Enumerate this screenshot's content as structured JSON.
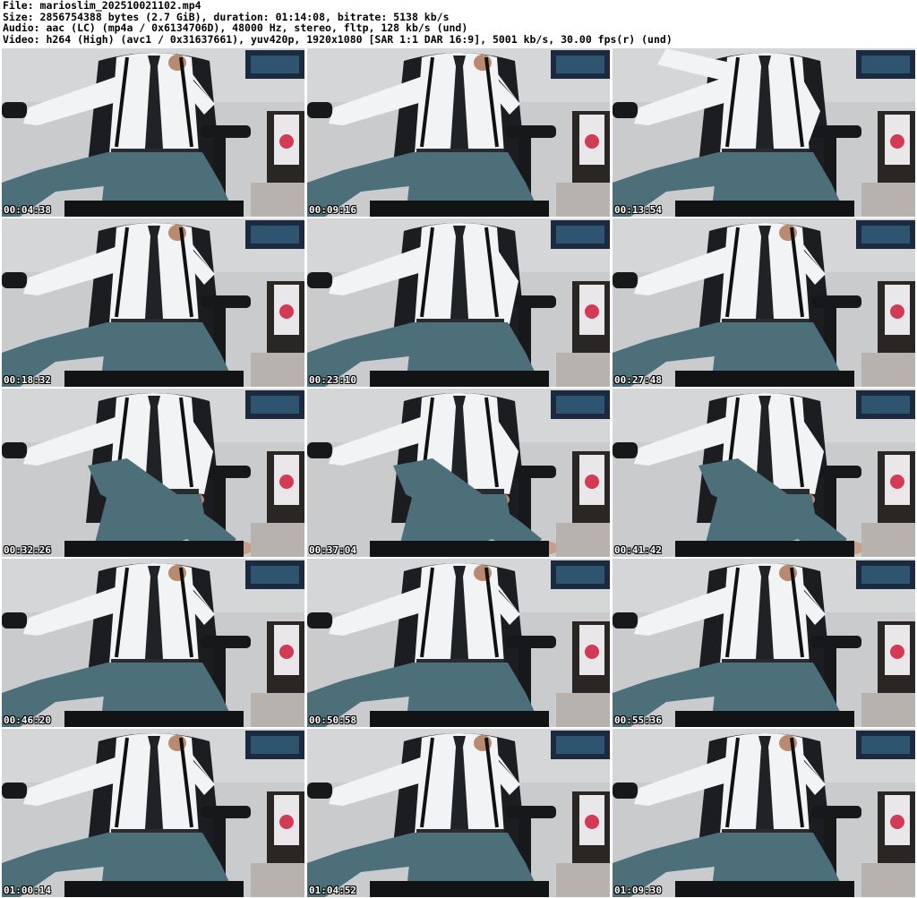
{
  "header": {
    "file_line": "File: marioslim_202510021102.mp4",
    "size_line": "Size: 2856754388 bytes (2.7 GiB), duration: 01:14:08, bitrate: 5138 kb/s",
    "audio_line": "Audio: aac (LC) (mp4a / 0x6134706D), 48000 Hz, stereo, fltp, 128 kb/s (und)",
    "video_line": "Video: h264 (High) (avc1 / 0x31637661), yuv420p, 1920x1080 [SAR 1:1 DAR 16:9], 5001 kb/s, 30.00 fps(r) (und)"
  },
  "thumbnails": [
    {
      "timestamp": "00:04:38",
      "pose": "hand-to-face"
    },
    {
      "timestamp": "00:09:16",
      "pose": "hand-to-face"
    },
    {
      "timestamp": "00:13:54",
      "pose": "arm-raised"
    },
    {
      "timestamp": "00:18:32",
      "pose": "hand-to-face"
    },
    {
      "timestamp": "00:23:10",
      "pose": "hand-on-lap"
    },
    {
      "timestamp": "00:27:48",
      "pose": "hand-to-face"
    },
    {
      "timestamp": "00:32:26",
      "pose": "legs-crossed"
    },
    {
      "timestamp": "00:37:04",
      "pose": "legs-crossed"
    },
    {
      "timestamp": "00:41:42",
      "pose": "legs-crossed"
    },
    {
      "timestamp": "00:46:20",
      "pose": "hand-to-face"
    },
    {
      "timestamp": "00:50:58",
      "pose": "hand-to-face"
    },
    {
      "timestamp": "00:55:36",
      "pose": "hand-to-face"
    },
    {
      "timestamp": "01:00:14",
      "pose": "hand-to-face"
    },
    {
      "timestamp": "01:04:52",
      "pose": "hand-to-face"
    },
    {
      "timestamp": "01:09:30",
      "pose": "hand-to-face"
    }
  ],
  "colors": {
    "wall": "#c9cbcd",
    "shirt": "#f2f3f5",
    "jeans": "#4c6f7a",
    "tie": "#1f2326",
    "chair": "#1c1d20",
    "timestamp_text": "#ffffff"
  }
}
